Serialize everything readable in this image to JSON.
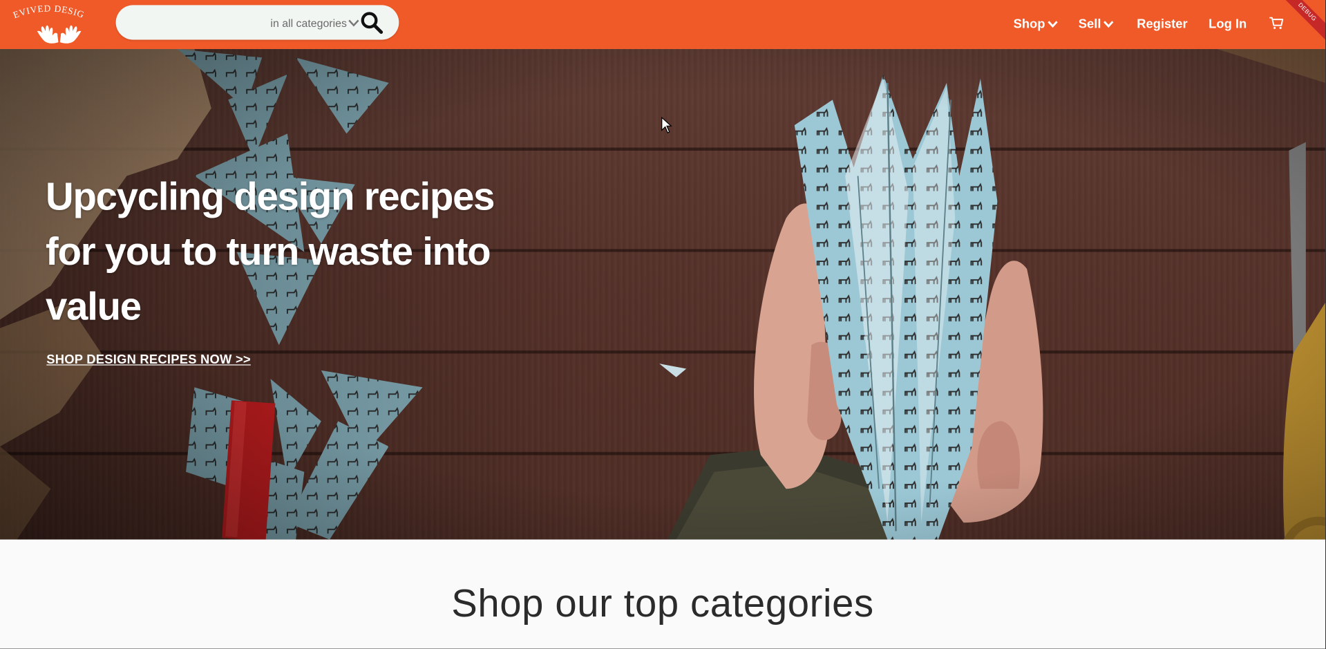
{
  "colors": {
    "brand": "#f05a28",
    "hero_text": "#ffffff",
    "section_bg": "#fafafa"
  },
  "header": {
    "logo_text": "REVIVED DESIGN",
    "search": {
      "placeholder": "",
      "category_label": "in all categories"
    },
    "nav": {
      "shop": "Shop",
      "sell": "Sell",
      "register": "Register",
      "login": "Log In"
    },
    "debug_banner": "DEBUG"
  },
  "hero": {
    "title": "Upcycling design recipes for you to turn waste into value",
    "cta": "SHOP DESIGN RECIPES NOW >>"
  },
  "categories_section": {
    "title": "Shop our top categories"
  },
  "icons": [
    "search-icon",
    "chevron-down-icon",
    "cart-icon",
    "hands-logo-icon",
    "mouse-cursor-icon"
  ]
}
